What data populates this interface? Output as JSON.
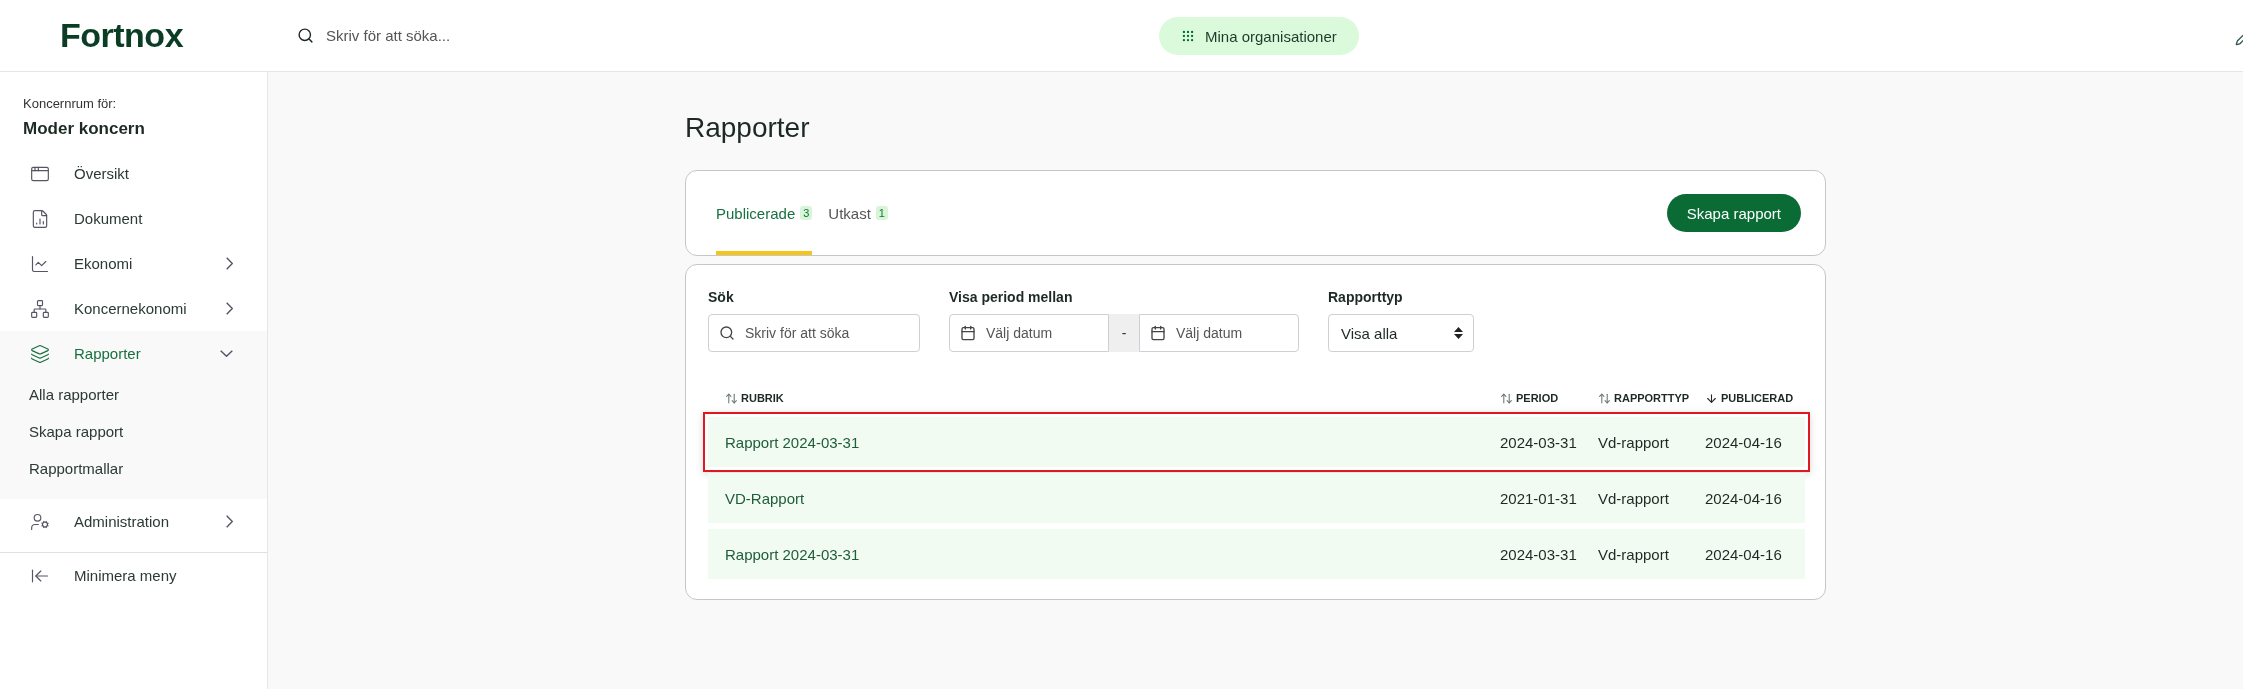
{
  "header": {
    "logo": "Fortnox",
    "search": {
      "placeholder": "Skriv för att söka..."
    },
    "org_button": "Mina organisationer"
  },
  "sidebar": {
    "context_label": "Koncernrum för:",
    "context_name": "Moder koncern",
    "items": [
      {
        "label": "Översikt",
        "has_submenu": false,
        "selected": false
      },
      {
        "label": "Dokument",
        "has_submenu": false,
        "selected": false
      },
      {
        "label": "Ekonomi",
        "has_submenu": true,
        "expanded": false,
        "selected": false
      },
      {
        "label": "Koncernekonomi",
        "has_submenu": true,
        "expanded": false,
        "selected": false
      },
      {
        "label": "Rapporter",
        "has_submenu": true,
        "expanded": true,
        "selected": true,
        "children": [
          {
            "label": "Alla rapporter"
          },
          {
            "label": "Skapa rapport"
          },
          {
            "label": "Rapportmallar"
          }
        ]
      },
      {
        "label": "Administration",
        "has_submenu": true,
        "expanded": false,
        "selected": false
      }
    ],
    "collapse": "Minimera meny"
  },
  "page": {
    "title": "Rapporter",
    "tabs": [
      {
        "label": "Publicerade",
        "count": "3",
        "selected": true
      },
      {
        "label": "Utkast",
        "count": "1",
        "selected": false
      }
    ],
    "create_button": "Skapa rapport",
    "filters": {
      "search": {
        "label": "Sök",
        "placeholder": "Skriv för att söka"
      },
      "period": {
        "label": "Visa period mellan",
        "from_placeholder": "Välj datum",
        "separator": "-",
        "to_placeholder": "Välj datum"
      },
      "type": {
        "label": "Rapporttyp",
        "value": "Visa alla"
      }
    },
    "table": {
      "columns": [
        {
          "label": "RUBRIK",
          "sorted": false
        },
        {
          "label": "PERIOD",
          "sorted": false
        },
        {
          "label": "RAPPORTTYP",
          "sorted": false
        },
        {
          "label": "PUBLICERAD",
          "sorted": true
        }
      ],
      "rows": [
        {
          "cells": [
            "Rapport 2024-03-31",
            "2024-03-31",
            "Vd-rapport",
            "2024-04-16"
          ],
          "highlighted": true
        },
        {
          "cells": [
            "VD-Rapport",
            "2021-01-31",
            "Vd-rapport",
            "2024-04-16"
          ],
          "highlighted": false
        },
        {
          "cells": [
            "Rapport 2024-03-31",
            "2024-03-31",
            "Vd-rapport",
            "2024-04-16"
          ],
          "highlighted": false
        }
      ]
    }
  }
}
